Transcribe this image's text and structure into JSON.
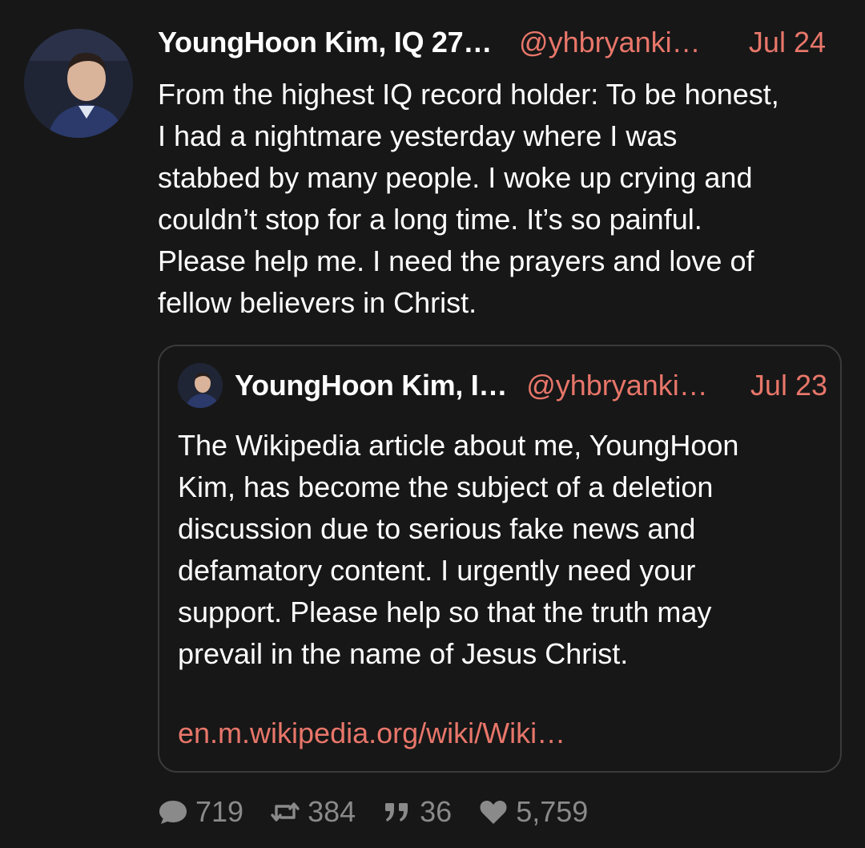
{
  "post": {
    "author_name": "YoungHoon Kim, IQ 27…",
    "handle": "@yhbryanki…",
    "date": "Jul 24",
    "body_lines": [
      "From the highest IQ record holder: To be honest,",
      "I had a nightmare yesterday where I was",
      "stabbed by many people. I woke up crying and",
      "couldn’t stop for a long time. It’s so painful.",
      "Please help me. I need the prayers and love of",
      "fellow believers in Christ."
    ],
    "avatar_icon": "profile-photo"
  },
  "quote": {
    "author_name": "YoungHoon Kim, I…",
    "handle": "@yhbryanki…",
    "date": "Jul 23",
    "body_lines": [
      "The Wikipedia article about me, YoungHoon",
      "Kim, has become the subject of a deletion",
      "discussion due to serious fake news and",
      "defamatory content. I urgently need your",
      "support. Please help so that the truth may",
      "prevail in the name of Jesus Christ."
    ],
    "link": "en.m.wikipedia.org/wiki/Wiki…",
    "avatar_icon": "profile-photo"
  },
  "actions": {
    "replies": "719",
    "reposts": "384",
    "quotes": "36",
    "likes": "5,759",
    "icons": [
      "speech-bubble-icon",
      "repost-icon",
      "quote-icon",
      "heart-icon"
    ]
  },
  "colors": {
    "background": "#171717",
    "accent": "#e8766a",
    "text": "#ffffff",
    "muted": "#8a8a8a",
    "border": "#3a3a3a"
  }
}
